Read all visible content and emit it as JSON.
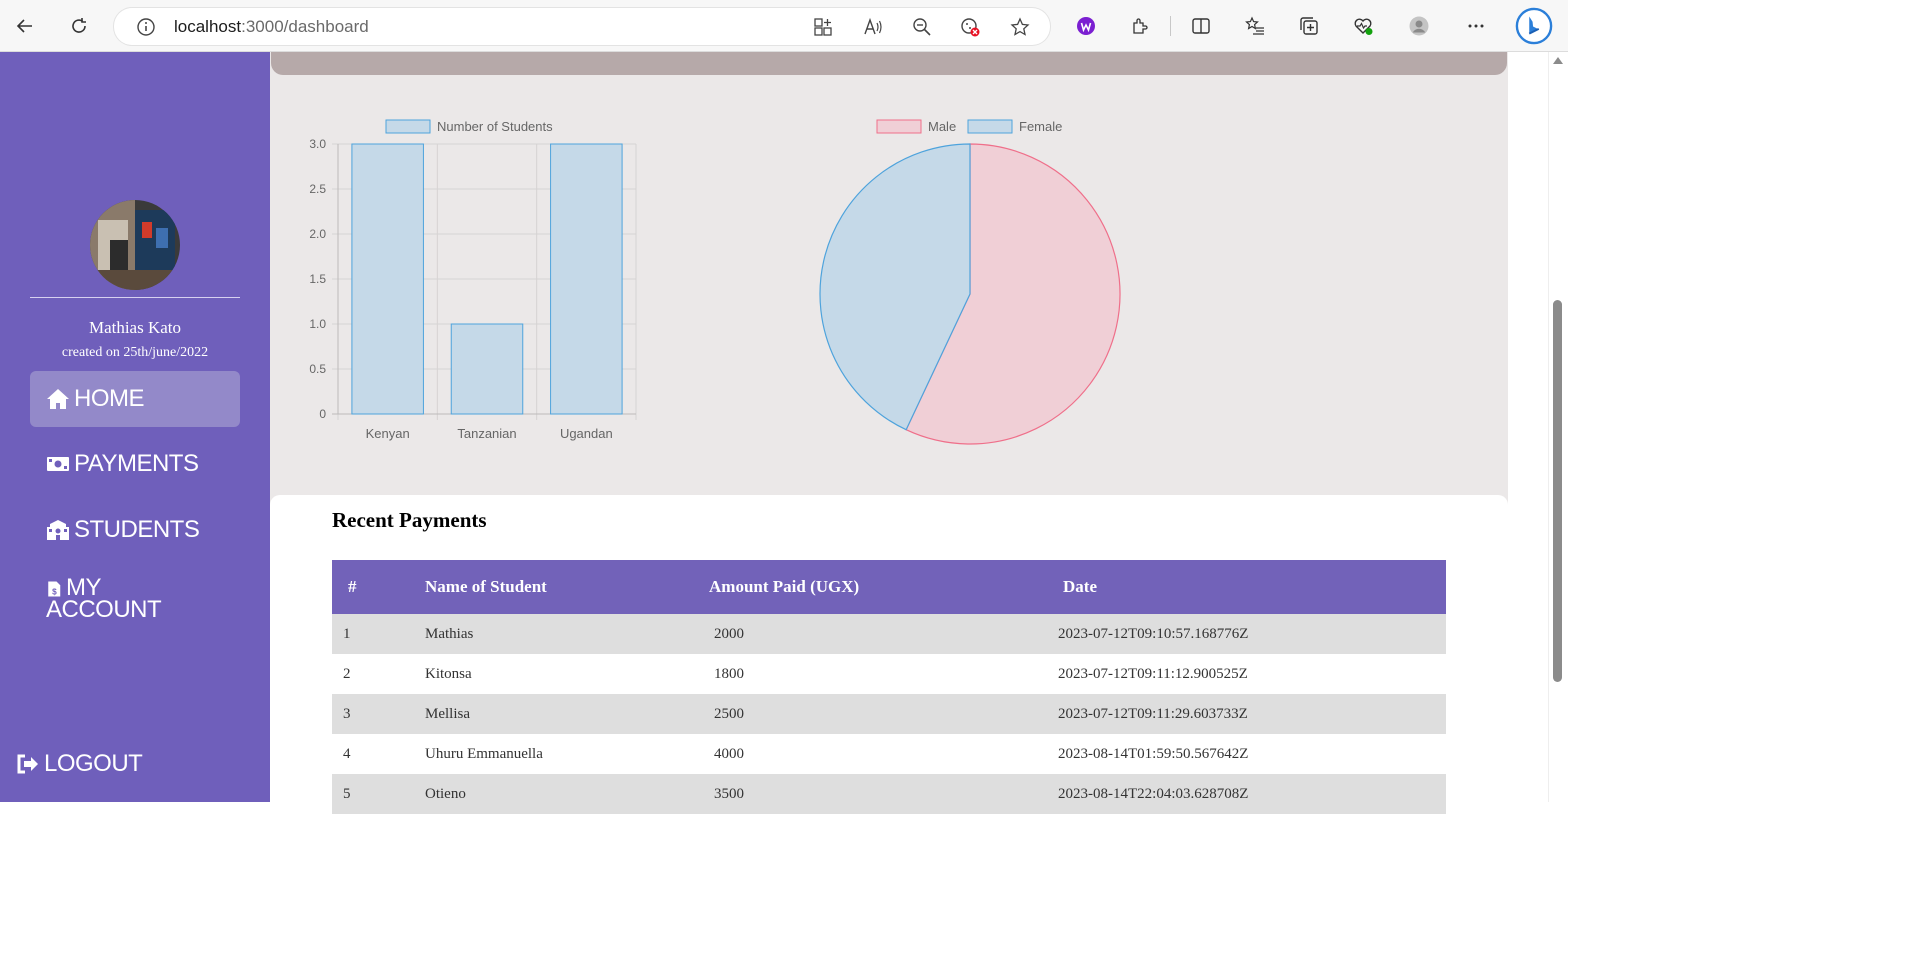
{
  "browser": {
    "url_host": "localhost",
    "url_path": ":3000/dashboard"
  },
  "sidebar": {
    "user_name": "Mathias Kato",
    "created": "created on 25th/june/2022",
    "items": [
      {
        "label": "HOME",
        "icon": "home-icon",
        "active": true
      },
      {
        "label": "PAYMENTS",
        "icon": "money-icon",
        "active": false
      },
      {
        "label": "STUDENTS",
        "icon": "school-icon",
        "active": false
      },
      {
        "label_line1": "MY",
        "label_line2": "ACCOUNT",
        "icon": "invoice-icon",
        "active": false
      },
      {
        "label": "LOGOUT",
        "icon": "logout-icon",
        "active": false
      }
    ]
  },
  "colors": {
    "sidebar": "#6f5fbb",
    "table_header": "#7262b9",
    "bar_fill": "#c5d9e8",
    "bar_border": "#4ea3dc",
    "male_fill": "#f0cfd6",
    "male_border": "#ef6f8a",
    "female_fill": "#c5d9e8",
    "female_border": "#4ea3dc"
  },
  "chart_data": [
    {
      "type": "bar",
      "legend": [
        "Number of Students"
      ],
      "legend_position": "top",
      "categories": [
        "Kenyan",
        "Tanzanian",
        "Ugandan"
      ],
      "values": [
        3,
        1,
        3
      ],
      "ylim": [
        0,
        3
      ],
      "yticks": [
        "3.0",
        "2.5",
        "2.0",
        "1.5",
        "1.0",
        "0.5",
        "0"
      ],
      "grid": true
    },
    {
      "type": "pie",
      "legend": [
        "Male",
        "Female"
      ],
      "legend_position": "top",
      "labels": [
        "Male",
        "Female"
      ],
      "values": [
        57,
        43
      ]
    }
  ],
  "payments": {
    "title": "Recent Payments",
    "headers": [
      "#",
      "Name of Student",
      "Amount Paid (UGX)",
      "Date"
    ],
    "rows": [
      [
        "1",
        "Mathias",
        "2000",
        "2023-07-12T09:10:57.168776Z"
      ],
      [
        "2",
        "Kitonsa",
        "1800",
        "2023-07-12T09:11:12.900525Z"
      ],
      [
        "3",
        "Mellisa",
        "2500",
        "2023-07-12T09:11:29.603733Z"
      ],
      [
        "4",
        "Uhuru Emmanuella",
        "4000",
        "2023-08-14T01:59:50.567642Z"
      ],
      [
        "5",
        "Otieno",
        "3500",
        "2023-08-14T22:04:03.628708Z"
      ]
    ]
  }
}
